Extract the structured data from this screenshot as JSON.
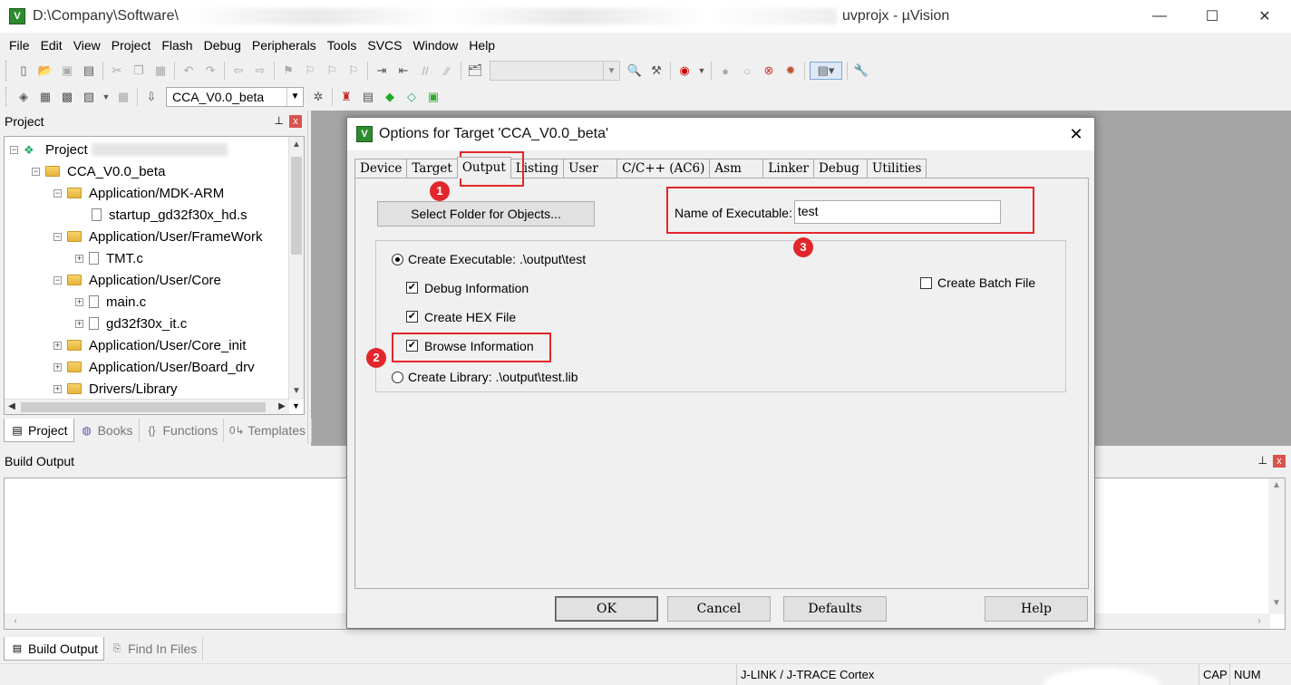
{
  "window": {
    "title_prefix": "D:\\Company\\Software\\",
    "title_suffix": "uvprojx - µVision",
    "minimize": "—",
    "maximize": "☐",
    "close": "✕"
  },
  "menu": [
    "File",
    "Edit",
    "View",
    "Project",
    "Flash",
    "Debug",
    "Peripherals",
    "Tools",
    "SVCS",
    "Window",
    "Help"
  ],
  "toolbar": {
    "target_combo_value": "CCA_V0.0_beta"
  },
  "project_panel": {
    "title": "Project",
    "pin": "📌",
    "close": "x",
    "tree": {
      "root": "Project",
      "target": "CCA_V0.0_beta",
      "groups": [
        {
          "label": "Application/MDK-ARM"
        },
        {
          "label": "startup_gd32f30x_hd.s"
        },
        {
          "label": "Application/User/FrameWork"
        },
        {
          "label": "TMT.c"
        },
        {
          "label": "Application/User/Core"
        },
        {
          "label": "main.c"
        },
        {
          "label": "gd32f30x_it.c"
        },
        {
          "label": "Application/User/Core_init"
        },
        {
          "label": "Application/User/Board_drv"
        },
        {
          "label": "Drivers/Library"
        }
      ]
    },
    "tabs": [
      "Project",
      "Books",
      "Functions",
      "Templates"
    ]
  },
  "build_output": {
    "title": "Build Output",
    "tabs": [
      "Build Output",
      "Find In Files"
    ]
  },
  "statusbar": {
    "debugger": "J-LINK / J-TRACE Cortex",
    "cap": "CAP",
    "num": "NUM"
  },
  "dialog": {
    "title": "Options for Target 'CCA_V0.0_beta'",
    "close": "✕",
    "tabs": [
      "Device",
      "Target",
      "Output",
      "Listing",
      "User",
      "C/C++ (AC6)",
      "Asm",
      "Linker",
      "Debug",
      "Utilities"
    ],
    "active_tab": "Output",
    "select_folder_button": "Select Folder for Objects...",
    "name_of_executable_label": "Name of Executable:",
    "name_of_executable_value": "test",
    "create_executable_label": "Create Executable:  .\\output\\test",
    "debug_information_label": "Debug Information",
    "create_hex_label": "Create HEX File",
    "browse_information_label": "Browse Information",
    "create_library_label": "Create Library:  .\\output\\test.lib",
    "create_batch_label": "Create Batch File",
    "ok_button": "OK",
    "cancel_button": "Cancel",
    "defaults_button": "Defaults",
    "help_button": "Help"
  },
  "annotations": {
    "badge1": "1",
    "badge2": "2",
    "badge3": "3",
    "accent_color": "#e3262b"
  }
}
